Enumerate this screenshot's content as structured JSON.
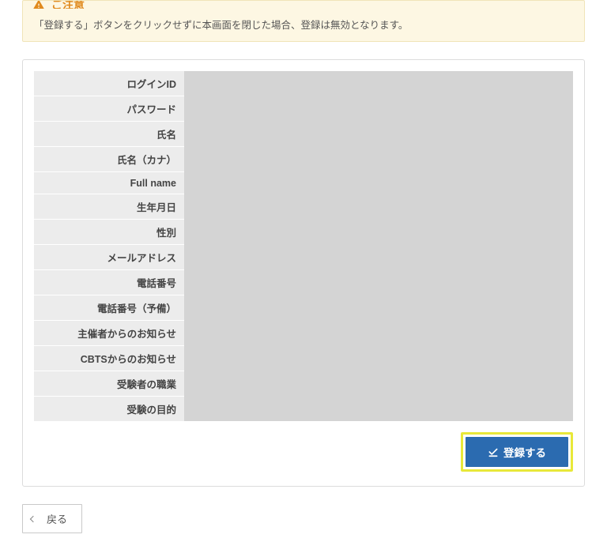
{
  "notice": {
    "title": "ご注意",
    "body": "「登録する」ボタンをクリックせずに本画面を閉じた場合、登録は無効となります。"
  },
  "form": {
    "rows": [
      {
        "label": "ログインID"
      },
      {
        "label": "パスワード"
      },
      {
        "label": "氏名"
      },
      {
        "label": "氏名（カナ）"
      },
      {
        "label": "Full name"
      },
      {
        "label": "生年月日"
      },
      {
        "label": "性別"
      },
      {
        "label": "メールアドレス"
      },
      {
        "label": "電話番号"
      },
      {
        "label": "電話番号（予備）"
      },
      {
        "label": "主催者からのお知らせ"
      },
      {
        "label": "CBTSからのお知らせ"
      },
      {
        "label": "受験者の職業"
      },
      {
        "label": "受験の目的"
      }
    ]
  },
  "buttons": {
    "register": "登録する",
    "back": "戻る"
  }
}
